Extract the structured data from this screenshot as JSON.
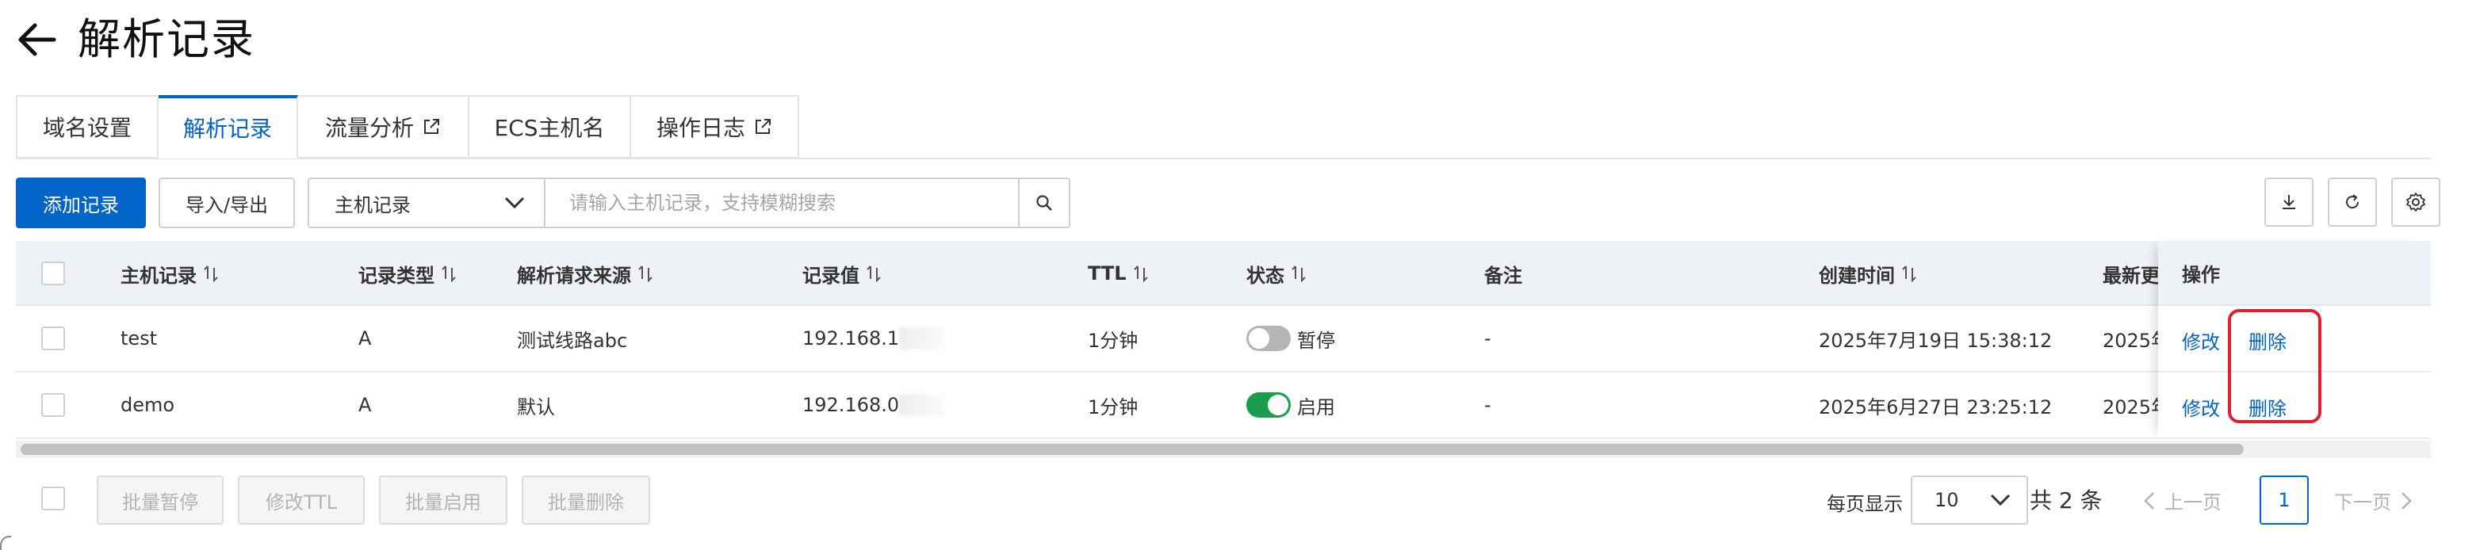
{
  "header": {
    "title": "解析记录",
    "back_icon": "arrow-left-icon"
  },
  "tabs": [
    {
      "label": "域名设置",
      "active": false,
      "external": false
    },
    {
      "label": "解析记录",
      "active": true,
      "external": false
    },
    {
      "label": "流量分析",
      "active": false,
      "external": true
    },
    {
      "label": "ECS主机名",
      "active": false,
      "external": false
    },
    {
      "label": "操作日志",
      "active": false,
      "external": true
    }
  ],
  "toolbar": {
    "add_label": "添加记录",
    "import_export_label": "导入/导出",
    "field_select": "主机记录",
    "search_placeholder": "请输入主机记录，支持模糊搜索",
    "search_icon": "search-icon",
    "download_icon": "download-icon",
    "refresh_icon": "refresh-icon",
    "settings_icon": "gear-icon"
  },
  "table": {
    "columns": {
      "host": "主机记录",
      "type": "记录类型",
      "source": "解析请求来源",
      "value": "记录值",
      "ttl": "TTL",
      "status": "状态",
      "remark": "备注",
      "created": "创建时间",
      "updated": "最新更",
      "actions": "操作"
    },
    "rows": [
      {
        "host": "test",
        "type": "A",
        "source": "测试线路abc",
        "value": "192.168.1",
        "ttl": "1分钟",
        "status": "暂停",
        "status_on": false,
        "remark": "-",
        "created": "2025年7月19日 15:38:12",
        "updated": "2025年",
        "edit": "修改",
        "delete": "删除"
      },
      {
        "host": "demo",
        "type": "A",
        "source": "默认",
        "value": "192.168.0",
        "ttl": "1分钟",
        "status": "启用",
        "status_on": true,
        "remark": "-",
        "created": "2025年6月27日 23:25:12",
        "updated": "2025年",
        "edit": "修改",
        "delete": "删除"
      }
    ]
  },
  "bulk": {
    "pause": "批量暂停",
    "edit_ttl": "修改TTL",
    "enable": "批量启用",
    "delete": "批量删除"
  },
  "pagination": {
    "per_page_label": "每页显示",
    "per_page_value": "10",
    "total": "共 2 条",
    "prev": "上一页",
    "current": "1",
    "next": "下一页"
  },
  "colors": {
    "primary": "#0064c8",
    "toggle_on": "#1a9e4b",
    "highlight": "#e0202c"
  }
}
